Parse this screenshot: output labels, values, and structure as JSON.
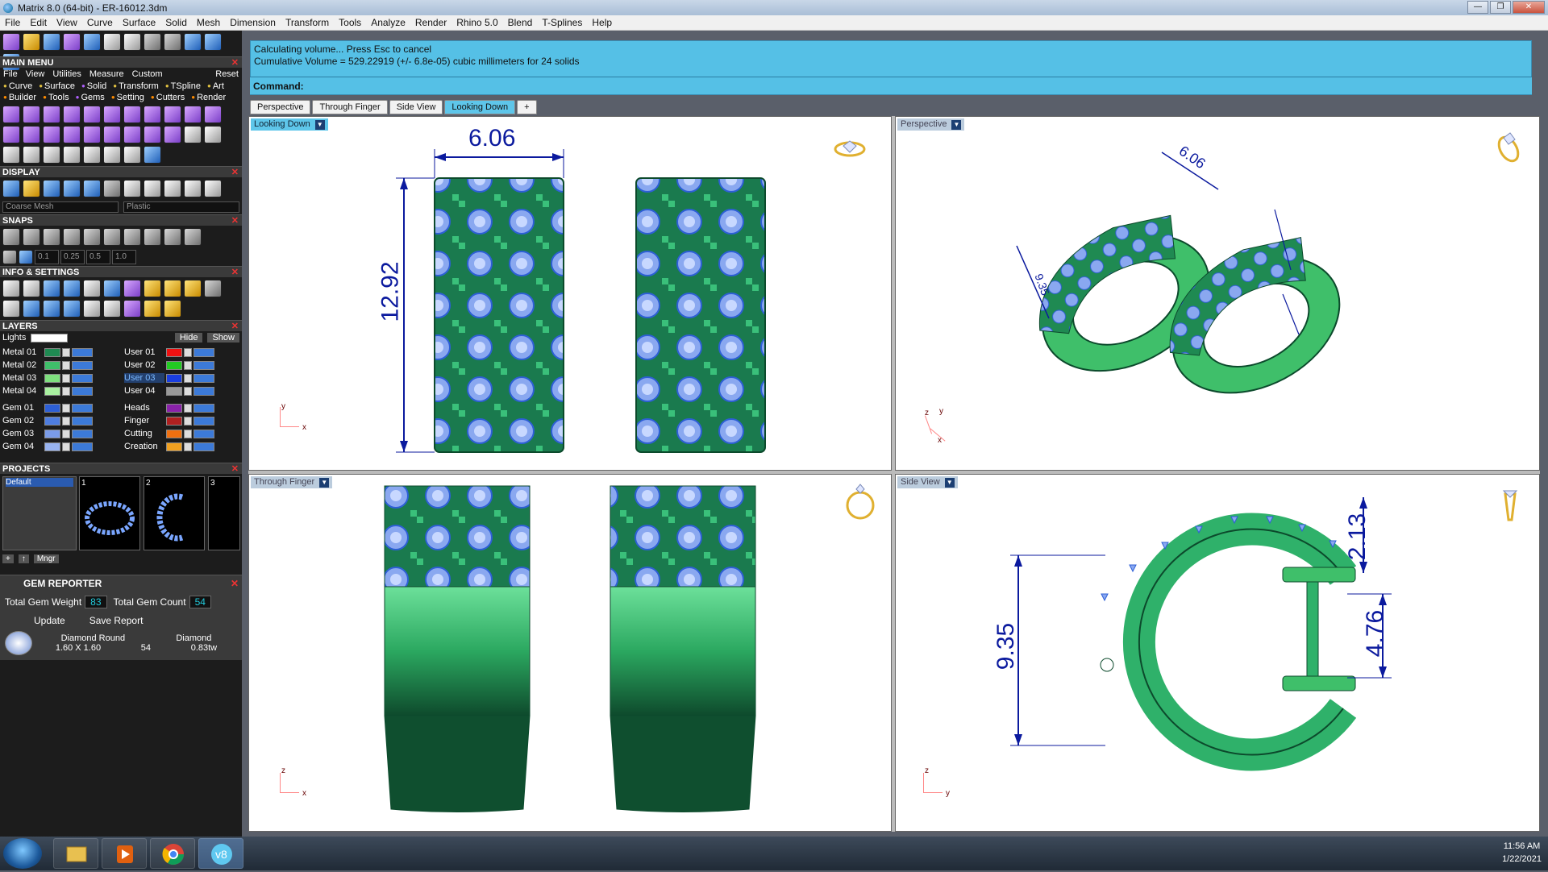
{
  "window": {
    "title": "Matrix 8.0 (64-bit) - ER-16012.3dm"
  },
  "menu": [
    "File",
    "Edit",
    "View",
    "Curve",
    "Surface",
    "Solid",
    "Mesh",
    "Dimension",
    "Transform",
    "Tools",
    "Analyze",
    "Render",
    "Rhino 5.0",
    "Blend",
    "T-Splines",
    "Help"
  ],
  "left": {
    "main_menu_title": "MAIN MENU",
    "main_menu_items": [
      "File",
      "View",
      "Utilities",
      "Measure",
      "Custom"
    ],
    "reset": "Reset",
    "categories1": [
      "Curve",
      "Surface",
      "Solid",
      "Transform",
      "TSpline",
      "Art"
    ],
    "categories2": [
      "Builder",
      "Tools",
      "Gems",
      "Setting",
      "Cutters",
      "Render"
    ],
    "display_title": "DISPLAY",
    "display_mode": "Coarse Mesh",
    "material": "Plastic",
    "snaps_title": "SNAPS",
    "snap_values": [
      "0.1",
      "0.25",
      "0.5",
      "1.0"
    ],
    "info_title": "INFO & SETTINGS",
    "layers_title": "LAYERS",
    "lights": "Lights",
    "hide": "Hide",
    "show": "Show",
    "layers_left": [
      {
        "name": "Metal 01",
        "color": "#1f8a52"
      },
      {
        "name": "Metal 02",
        "color": "#3fbf6a"
      },
      {
        "name": "Metal 03",
        "color": "#7ee07e"
      },
      {
        "name": "Metal 04",
        "color": "#a9f0a0"
      },
      {
        "name": "Gem 01",
        "color": "#2d5fd6"
      },
      {
        "name": "Gem 02",
        "color": "#4e7de0"
      },
      {
        "name": "Gem 03",
        "color": "#7a9be8"
      },
      {
        "name": "Gem 04",
        "color": "#98b3f0"
      }
    ],
    "layers_right": [
      {
        "name": "User 01",
        "color": "#e11"
      },
      {
        "name": "User 02",
        "color": "#2c2"
      },
      {
        "name": "User 03",
        "color": "#1a3ee0"
      },
      {
        "name": "User 04",
        "color": "#999"
      },
      {
        "name": "Heads",
        "color": "#8a22aa"
      },
      {
        "name": "Finger",
        "color": "#b02020"
      },
      {
        "name": "Cutting",
        "color": "#f07010"
      },
      {
        "name": "Creation",
        "color": "#f0a020"
      }
    ],
    "projects_title": "PROJECTS",
    "project_default": "Default",
    "project_thumbs": [
      "1",
      "2",
      "3"
    ],
    "mngr": "Mngr",
    "gem_reporter_title": "GEM REPORTER",
    "total_gem_weight_label": "Total Gem Weight",
    "total_gem_weight": "83",
    "total_gem_count_label": "Total Gem Count",
    "total_gem_count": "54",
    "update": "Update",
    "save_report": "Save Report",
    "gem_shape": "Diamond Round",
    "gem_type": "Diamond",
    "gem_size": "1.60 X 1.60",
    "gem_count": "54",
    "gem_weight": "0.83tw"
  },
  "command": {
    "line1": "Calculating volume... Press Esc to cancel",
    "line2": "Cumulative Volume = 529.22919 (+/- 6.8e-05) cubic millimeters for 24 solids",
    "prompt": "Command:"
  },
  "tabs": [
    "Perspective",
    "Through Finger",
    "Side View",
    "Looking Down",
    "+"
  ],
  "viewports": {
    "looking_down": {
      "label": "Looking Down",
      "dim_w": "6.06",
      "dim_h": "12.92",
      "axis_y": "y",
      "axis_x": "x"
    },
    "perspective": {
      "label": "Perspective",
      "dim_top": "6.06",
      "dim_left": "9.35",
      "axis_z": "z",
      "axis_y": "y",
      "axis_x": "x"
    },
    "through_finger": {
      "label": "Through Finger",
      "axis_z": "z",
      "axis_x": "x"
    },
    "side_view": {
      "label": "Side View",
      "dim_top": "2.13",
      "dim_left": "9.35",
      "dim_right": "4.76",
      "axis_z": "z",
      "axis_y": "y"
    }
  },
  "tray": {
    "time": "11:56 AM",
    "date": "1/22/2021"
  }
}
